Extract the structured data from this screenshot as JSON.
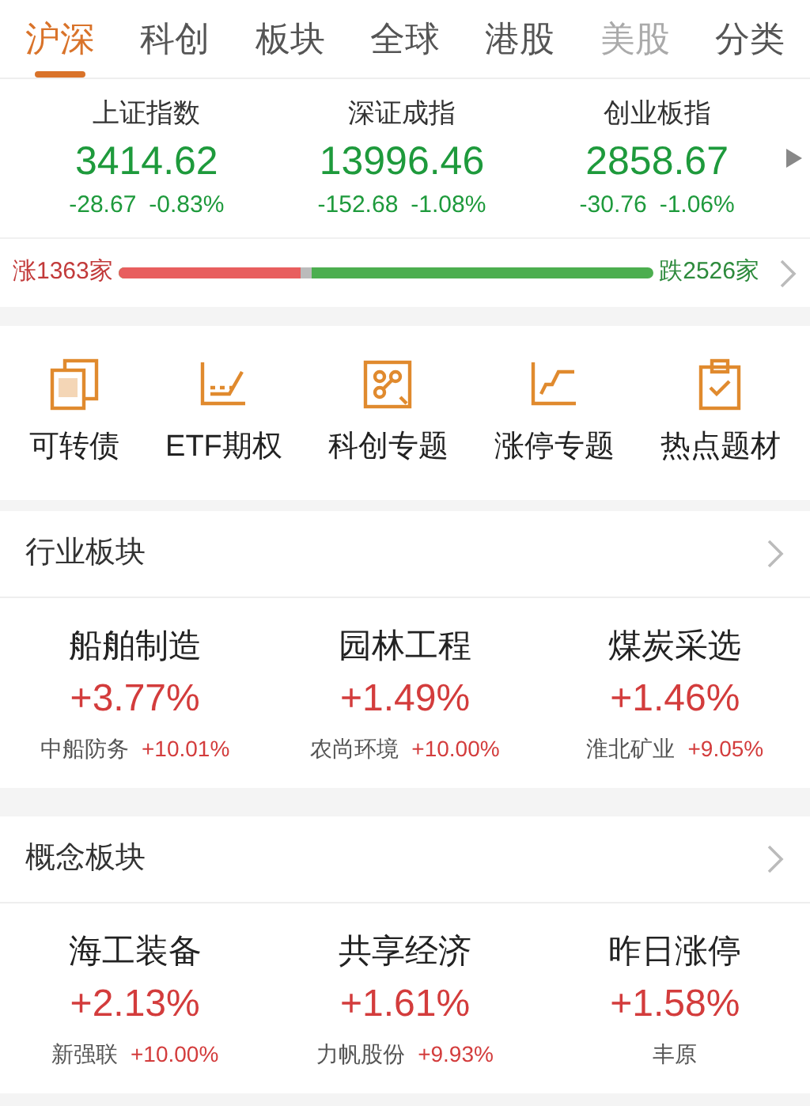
{
  "tabs": [
    {
      "label": "沪深",
      "selected": true
    },
    {
      "label": "科创",
      "selected": false
    },
    {
      "label": "板块",
      "selected": false
    },
    {
      "label": "全球",
      "selected": false
    },
    {
      "label": "港股",
      "selected": false
    },
    {
      "label": "美股",
      "selected": false
    },
    {
      "label": "分类",
      "selected": false
    }
  ],
  "indices": [
    {
      "name": "上证指数",
      "value": "3414.62",
      "change": "-28.67",
      "pct": "-0.83%"
    },
    {
      "name": "深证成指",
      "value": "13996.46",
      "change": "-152.68",
      "pct": "-1.08%"
    },
    {
      "name": "创业板指",
      "value": "2858.67",
      "change": "-30.76",
      "pct": "-1.06%"
    }
  ],
  "breadth": {
    "rising": {
      "label": "涨1363家",
      "level": 0.34
    },
    "falling": {
      "label": "跌2526家"
    }
  },
  "shortcuts": [
    {
      "kind": "bond",
      "label": "可转债"
    },
    {
      "kind": "option",
      "label": "ETF期权"
    },
    {
      "kind": "link",
      "label": "科创专题"
    },
    {
      "kind": "step",
      "label": "涨停专题"
    },
    {
      "kind": "clipboard",
      "label": "热点题材"
    }
  ],
  "sections": [
    {
      "title": "行业板块",
      "items": [
        {
          "name": "船舶制造",
          "pct": "+3.77%",
          "stock": "中船防务",
          "stock_pct": "+10.01%"
        },
        {
          "name": "园林工程",
          "pct": "+1.49%",
          "stock": "农尚环境",
          "stock_pct": "+10.00%"
        },
        {
          "name": "煤炭采选",
          "pct": "+1.46%",
          "stock": "淮北矿业",
          "stock_pct": "+9.05%"
        }
      ]
    },
    {
      "title": "概念板块",
      "items": [
        {
          "name": "海工装备",
          "pct": "+2.13%",
          "stock": "新强联",
          "stock_pct": "+10.00%"
        },
        {
          "name": "共享经济",
          "pct": "+1.61%",
          "stock": "力帆股份",
          "stock_pct": "+9.93%"
        },
        {
          "name": "昨日涨停",
          "pct": "+1.58%",
          "stock": "丰原"
        }
      ]
    }
  ]
}
